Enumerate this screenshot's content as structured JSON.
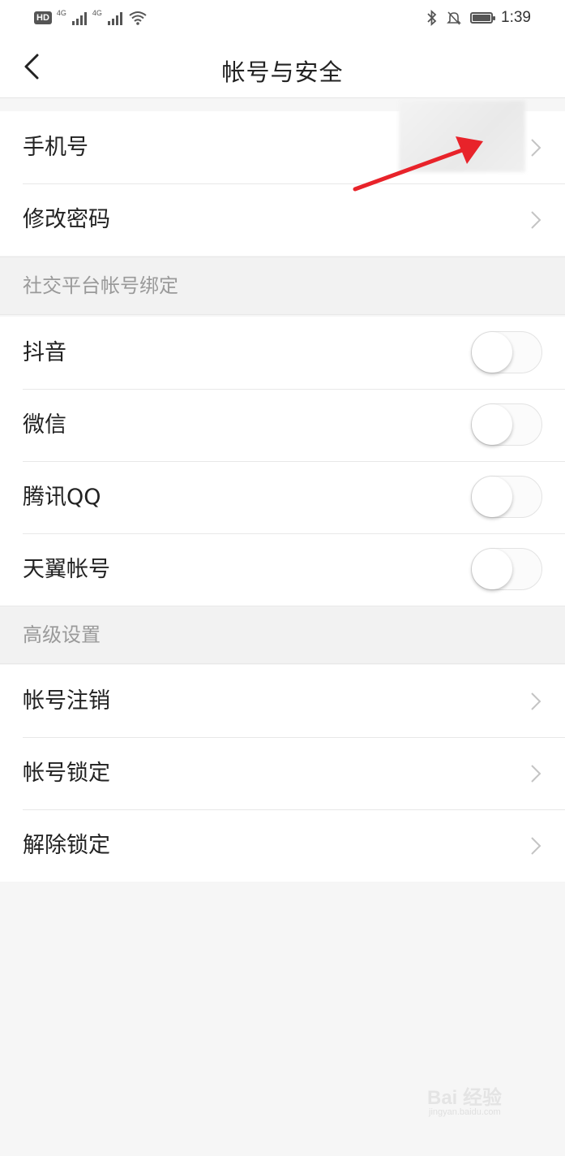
{
  "status_bar": {
    "hd_badge": "HD",
    "network_1": "4G",
    "network_2": "4G",
    "time": "1:39"
  },
  "nav": {
    "title": "帐号与安全"
  },
  "account_rows": [
    {
      "label": "手机号"
    },
    {
      "label": "修改密码"
    }
  ],
  "social_section": {
    "header": "社交平台帐号绑定",
    "items": [
      {
        "label": "抖音",
        "enabled": false
      },
      {
        "label": "微信",
        "enabled": false
      },
      {
        "label": "腾讯QQ",
        "enabled": false
      },
      {
        "label": "天翼帐号",
        "enabled": false
      }
    ]
  },
  "advanced_section": {
    "header": "高级设置",
    "items": [
      {
        "label": "帐号注销"
      },
      {
        "label": "帐号锁定"
      },
      {
        "label": "解除锁定"
      }
    ]
  },
  "annotation": {
    "arrow_color": "#e8232a"
  },
  "watermark": {
    "text": "Bai 经验",
    "sub": "jingyan.baidu.com"
  },
  "colors": {
    "background": "#f6f6f6",
    "section_header_text": "#9a9a9a",
    "divider": "#e8e8e8"
  }
}
